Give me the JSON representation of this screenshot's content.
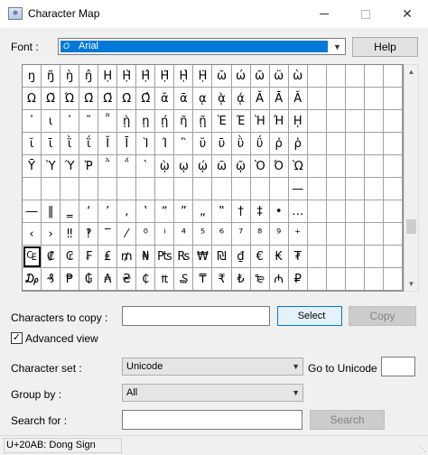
{
  "window": {
    "title": "Character Map",
    "close_glyph": "✕"
  },
  "font": {
    "label": "Font :",
    "value": "Arial",
    "help_label": "Help",
    "ot_mark": "O"
  },
  "grid": {
    "rows": [
      [
        "ŋ",
        "ŋ̃",
        "ŋ̀",
        "ŋ̂",
        "Ḥ",
        "Ḥ̀",
        "Ḥ̂",
        "Ḥ̃",
        "Ḥ̉",
        "Ḥ̈",
        "ω̆",
        "ώ",
        "ω̃",
        "ω̈",
        "ὼ"
      ],
      [
        "Ω",
        "Ω̆",
        "Ώ",
        "Ω̃",
        "Ω̈",
        "Ω̇",
        "Ω̂",
        "ᾰ",
        "ᾱ",
        "ᾳ",
        "ᾲ",
        "ᾴ",
        "Ᾰ",
        "Ᾱ",
        "Ᾰ"
      ],
      [
        "᾽",
        "ι",
        "᾿",
        "῀",
        "῁",
        "ῂ",
        "ῃ",
        "ῄ",
        "ῆ",
        "ῇ",
        "Ὲ",
        "Έ",
        "Ὴ",
        "Ή",
        "ῌ"
      ],
      [
        "ῐ",
        "ῑ",
        "ῒ",
        "ΐ",
        "Ῐ",
        "Ῑ",
        "Ὶ",
        "Ί",
        "῝",
        "ῠ",
        "ῡ",
        "ῢ",
        "ΰ",
        "ῤ",
        "ῥ"
      ],
      [
        "Ῡ",
        "Ὺ",
        "Ύ",
        "Ῥ",
        "῭",
        "΅",
        "`",
        "ῲ",
        "ῳ",
        "ῴ",
        "ῶ",
        "ῷ",
        "Ὸ",
        "Ό",
        "Ὼ"
      ],
      [
        "",
        "",
        "",
        "",
        "",
        "",
        "",
        "",
        "",
        "",
        "",
        "",
        "",
        "",
        "—"
      ],
      [
        "―",
        "‖",
        "‗",
        "‘",
        "’",
        "‚",
        "‛",
        "“",
        "”",
        "„",
        "‟",
        "†",
        "‡",
        "•",
        "…"
      ],
      [
        "‹",
        "›",
        "‼",
        "‽",
        "‾",
        "⁄",
        "⁰",
        "ⁱ",
        "⁴",
        "⁵",
        "⁶",
        "⁷",
        "⁸",
        "⁹",
        "⁺"
      ],
      [
        "₠",
        "₡",
        "₢",
        "₣",
        "₤",
        "₥",
        "₦",
        "₧",
        "₨",
        "₩",
        "₪",
        "₫",
        "€",
        "₭",
        "₮"
      ],
      [
        "₯",
        "₰",
        "₱",
        "₲",
        "₳",
        "₴",
        "₵",
        "₶",
        "₷",
        "₸",
        "₹",
        "₺",
        "₻",
        "₼",
        "₽"
      ]
    ]
  },
  "copy": {
    "label": "Characters to copy :",
    "value": "",
    "select_label": "Select",
    "copy_label": "Copy"
  },
  "advanced": {
    "label": "Advanced view",
    "checked": "✓"
  },
  "charset": {
    "label": "Character set :",
    "value": "Unicode",
    "goto_label": "Go to Unicode :",
    "goto_value": ""
  },
  "group": {
    "label": "Group by :",
    "value": "All"
  },
  "search": {
    "label": "Search for :",
    "value": "",
    "button_label": "Search"
  },
  "status": {
    "text": "U+20AB: Dong Sign"
  }
}
